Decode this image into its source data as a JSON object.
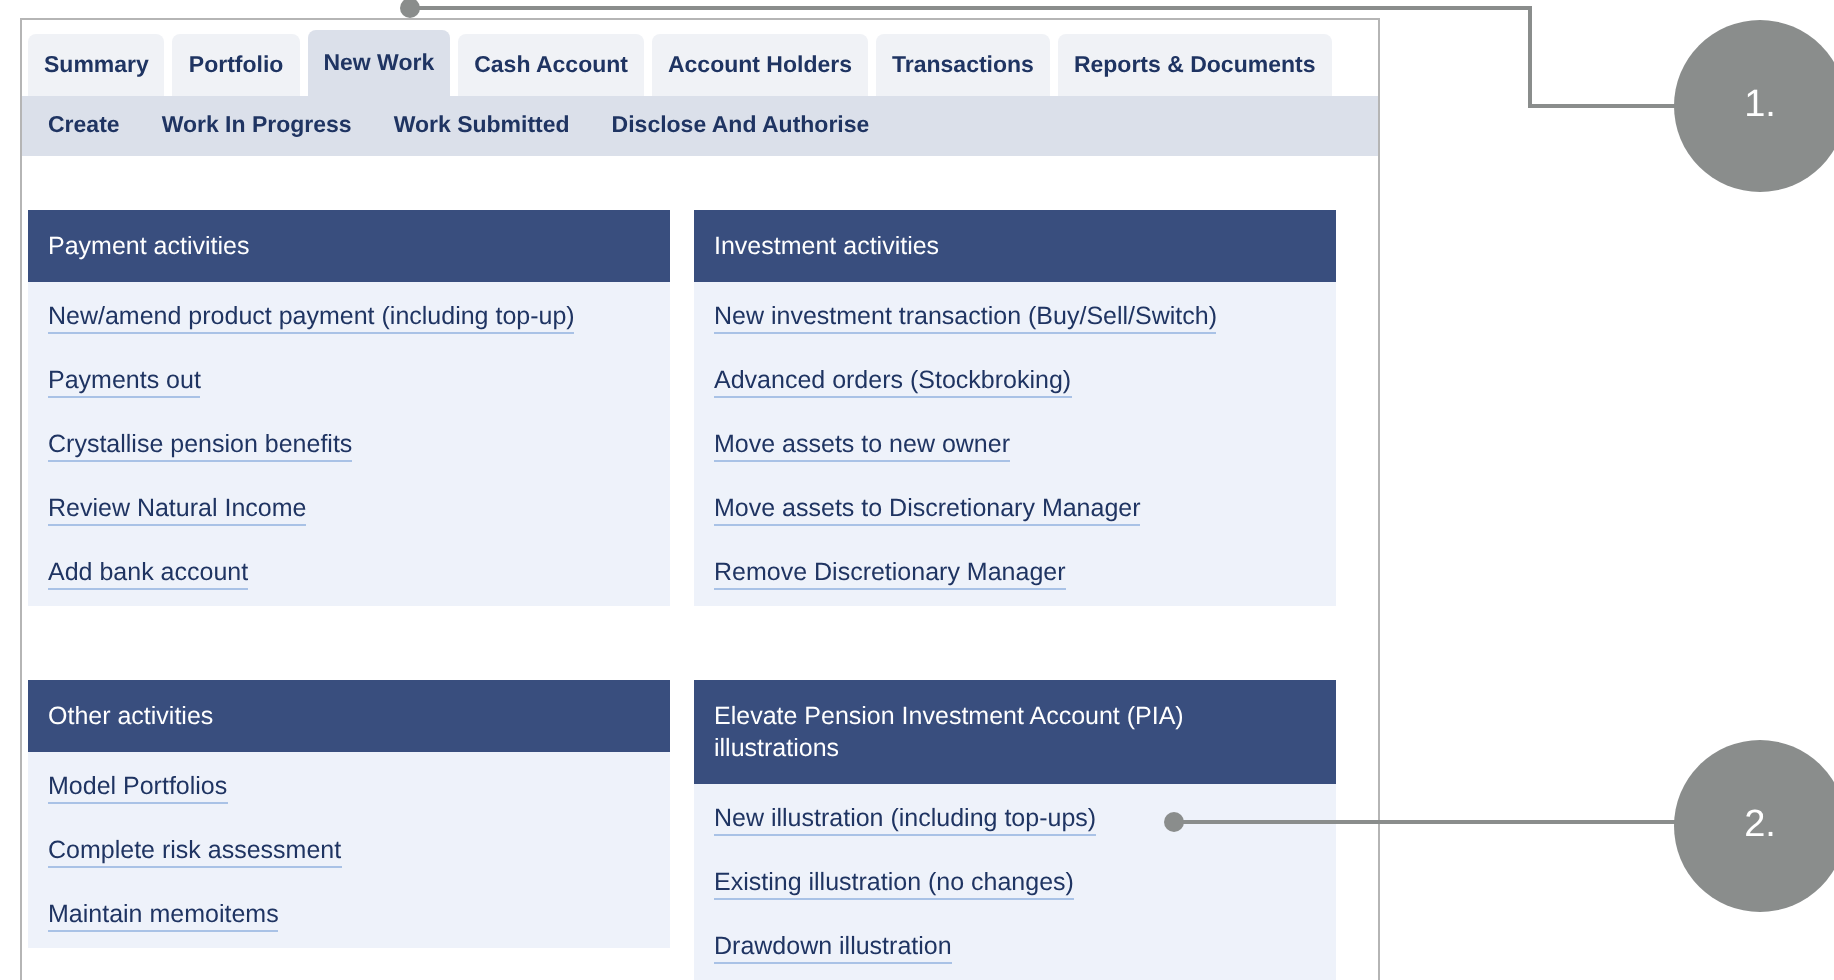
{
  "tabs": [
    {
      "label": "Summary",
      "selected": false
    },
    {
      "label": "Portfolio",
      "selected": false
    },
    {
      "label": "New Work",
      "selected": true
    },
    {
      "label": "Cash Account",
      "selected": false
    },
    {
      "label": "Account Holders",
      "selected": false
    },
    {
      "label": "Transactions",
      "selected": false
    },
    {
      "label": "Reports & Documents",
      "selected": false
    }
  ],
  "subnav": [
    "Create",
    "Work In Progress",
    "Work Submitted",
    "Disclose And Authorise"
  ],
  "sections": [
    [
      {
        "title": "Payment activities",
        "links": [
          "New/amend product payment (including top-up)",
          "Payments out",
          "Crystallise pension benefits",
          "Review Natural Income",
          "Add bank account"
        ]
      },
      {
        "title": "Investment activities",
        "links": [
          "New investment transaction (Buy/Sell/Switch)",
          "Advanced orders (Stockbroking)",
          "Move assets to new owner",
          "Move assets to Discretionary Manager",
          "Remove Discretionary Manager"
        ]
      }
    ],
    [
      {
        "title": "Other activities",
        "links": [
          "Model Portfolios",
          "Complete risk assessment",
          "Maintain memoitems"
        ]
      },
      {
        "title": "Elevate Pension Investment Account (PIA) illustrations",
        "links": [
          "New illustration (including top-ups)",
          "Existing illustration (no changes)",
          "Drawdown illustration"
        ]
      }
    ]
  ],
  "callouts": [
    {
      "label": "1."
    },
    {
      "label": "2."
    }
  ]
}
